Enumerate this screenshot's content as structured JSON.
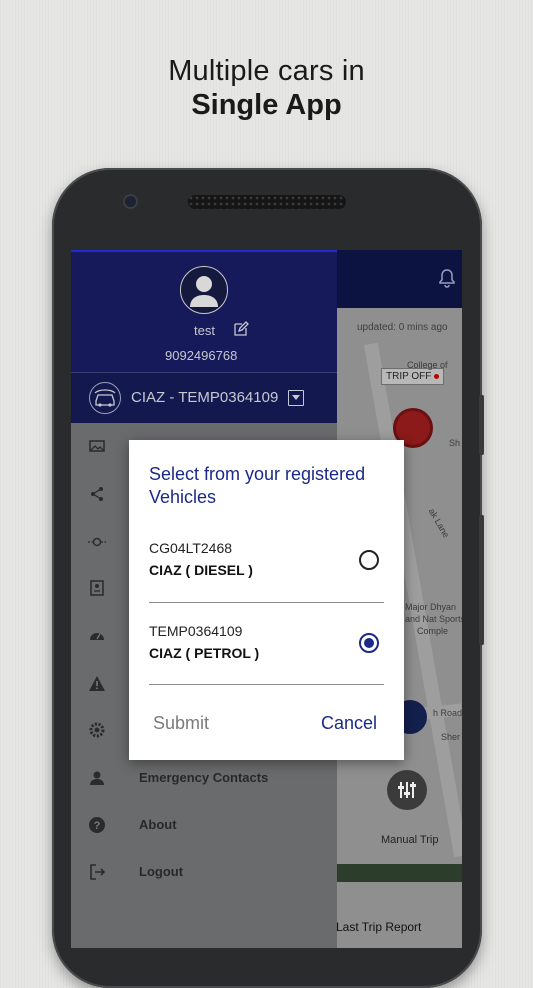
{
  "headline": {
    "line1": "Multiple cars in",
    "line2": "Single App"
  },
  "header": {
    "updated": "updated: 0 mins ago",
    "bell_icon": "bell-icon"
  },
  "drawer": {
    "username": "test",
    "phone": "9092496768",
    "selected_vehicle": "CIAZ - TEMP0364109",
    "menu": [
      {
        "icon": "image-icon",
        "label": ""
      },
      {
        "icon": "share-icon",
        "label": ""
      },
      {
        "icon": "car-route-icon",
        "label": ""
      },
      {
        "icon": "document-icon",
        "label": ""
      },
      {
        "icon": "speedometer-icon",
        "label": ""
      },
      {
        "icon": "warning-icon",
        "label": ""
      },
      {
        "icon": "settings-icon",
        "label": ""
      },
      {
        "icon": "contacts-icon",
        "label": "Emergency Contacts"
      },
      {
        "icon": "help-icon",
        "label": "About"
      },
      {
        "icon": "logout-icon",
        "label": "Logout"
      }
    ]
  },
  "map": {
    "trip_status": "TRIP OFF",
    "labels": [
      "College of",
      "Sh",
      "ak Lane",
      "Major Dhyan",
      "and Nat Sports",
      "Comple",
      "h Road",
      "Sher",
      "Manual Trip"
    ],
    "last_trip": "Last Trip Report"
  },
  "dialog": {
    "title": "Select from your registered Vehicles",
    "options": [
      {
        "reg": "CG04LT2468",
        "model": "CIAZ ( DIESEL )",
        "selected": false
      },
      {
        "reg": "TEMP0364109",
        "model": "CIAZ ( PETROL )",
        "selected": true
      }
    ],
    "submit": "Submit",
    "cancel": "Cancel"
  },
  "colors": {
    "accent": "#1b2a86",
    "drawer_header": "#161a5a"
  }
}
